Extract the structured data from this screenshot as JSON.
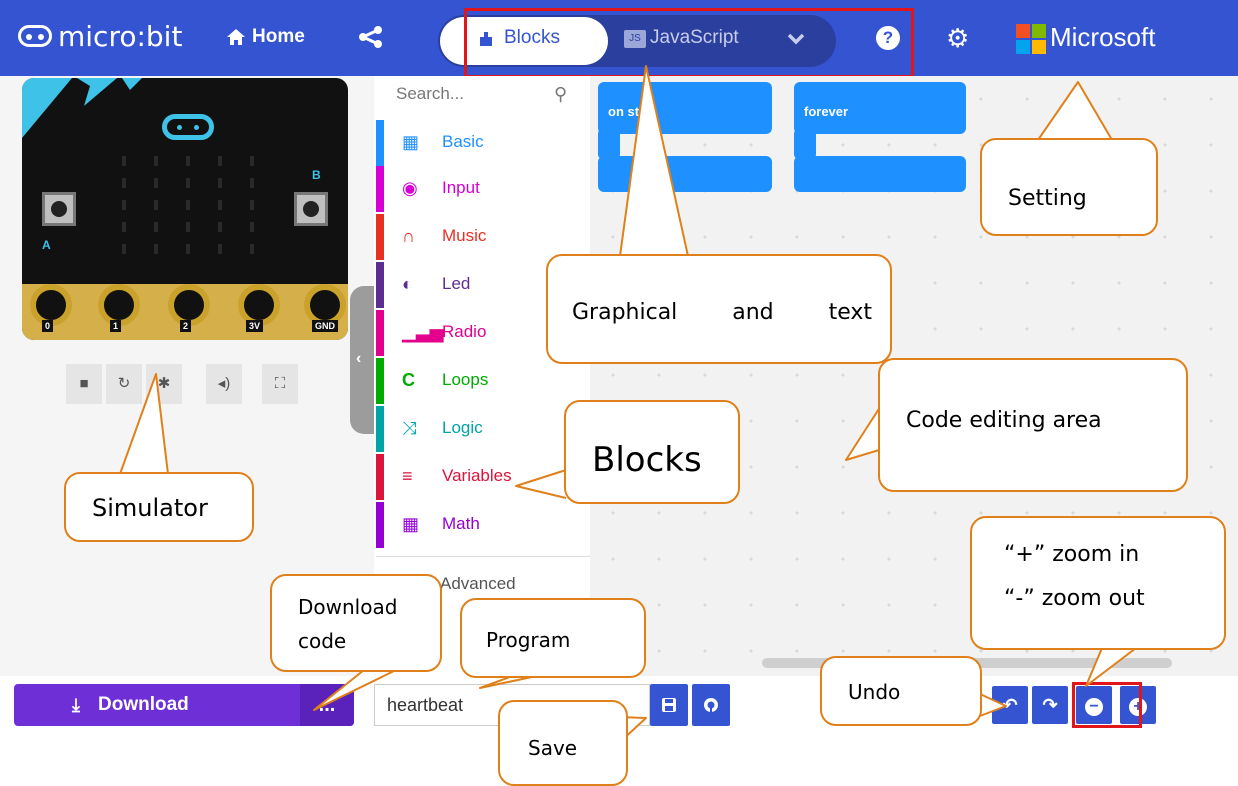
{
  "header": {
    "logo_text": "micro:bit",
    "home_label": "Home",
    "mode_blocks_label": "Blocks",
    "mode_js_badge": "JS",
    "mode_js_label": "JavaScript",
    "brand_label": "Microsoft",
    "colors": {
      "bar": "#3454d1",
      "ms_red": "#f25022",
      "ms_green": "#7fba00",
      "ms_blue": "#00a4ef",
      "ms_yellow": "#ffb900"
    }
  },
  "simulator": {
    "pins": [
      "0",
      "1",
      "2",
      "3V",
      "GND"
    ],
    "button_a": "A",
    "button_b": "B",
    "controls": [
      "stop-icon",
      "restart-icon",
      "debug-icon",
      "mute-icon",
      "fullscreen-icon"
    ]
  },
  "toolbox": {
    "search_placeholder": "Search...",
    "categories": [
      {
        "label": "Basic",
        "color": "#1e90ff",
        "icon": "grid-icon"
      },
      {
        "label": "Input",
        "color": "#d400d4",
        "icon": "target-icon"
      },
      {
        "label": "Music",
        "color": "#e63022",
        "icon": "headphones-icon"
      },
      {
        "label": "Led",
        "color": "#5c2d91",
        "icon": "toggle-icon"
      },
      {
        "label": "Radio",
        "color": "#e3008c",
        "icon": "signal-icon"
      },
      {
        "label": "Loops",
        "color": "#00aa00",
        "icon": "loop-icon"
      },
      {
        "label": "Logic",
        "color": "#00a4a6",
        "icon": "shuffle-icon"
      },
      {
        "label": "Variables",
        "color": "#dc143c",
        "icon": "list-icon"
      },
      {
        "label": "Math",
        "color": "#9400d3",
        "icon": "calculator-icon"
      }
    ],
    "advanced_label": "Advanced"
  },
  "workspace": {
    "blocks": [
      {
        "title": "on start"
      },
      {
        "title": "forever"
      }
    ]
  },
  "bottom": {
    "download_label": "Download",
    "more_label": "...",
    "project_name": "heartbeat"
  },
  "callouts": {
    "graphical": "Graphical and text",
    "setting": "Setting",
    "code_area": "Code editing area",
    "blocks": "Blocks",
    "simulator": "Simulator",
    "download_code": "Download code",
    "program": "Program",
    "save": "Save",
    "undo": "Undo",
    "zoom_in": "“+” zoom in",
    "zoom_out": "“-” zoom out"
  }
}
